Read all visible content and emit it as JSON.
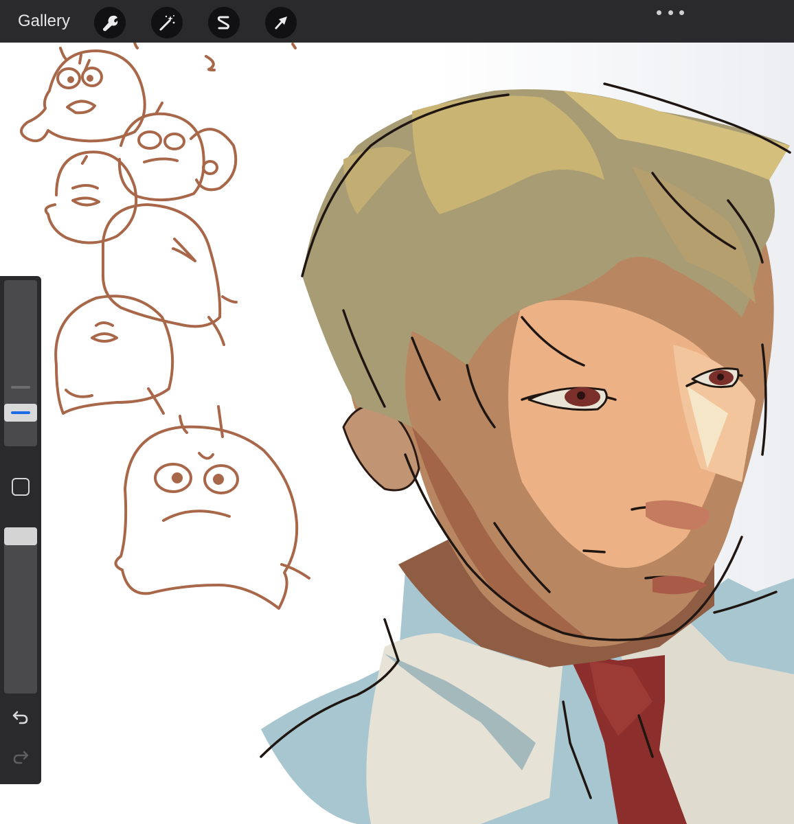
{
  "app": {
    "gallery_label": "Gallery"
  },
  "toolbar": {
    "icons": [
      "wrench-icon",
      "magic-wand-icon",
      "selection-icon",
      "transform-arrow-icon"
    ],
    "more_icon": "ellipsis-icon"
  },
  "sidebar": {
    "brush_size": 0.1,
    "brush_opacity": 1.0,
    "icons": [
      "modify-square-icon",
      "undo-icon",
      "redo-icon"
    ]
  },
  "colors": {
    "toolbar_bg": "#2a2a2c",
    "icon_button_bg": "#111113",
    "accent": "#1e6be8",
    "sketch_line": "#a9674a",
    "hair": "#a89c74",
    "skin": "#c08a62",
    "shirt": "#a7c6d0",
    "tie": "#8c2f2c"
  }
}
